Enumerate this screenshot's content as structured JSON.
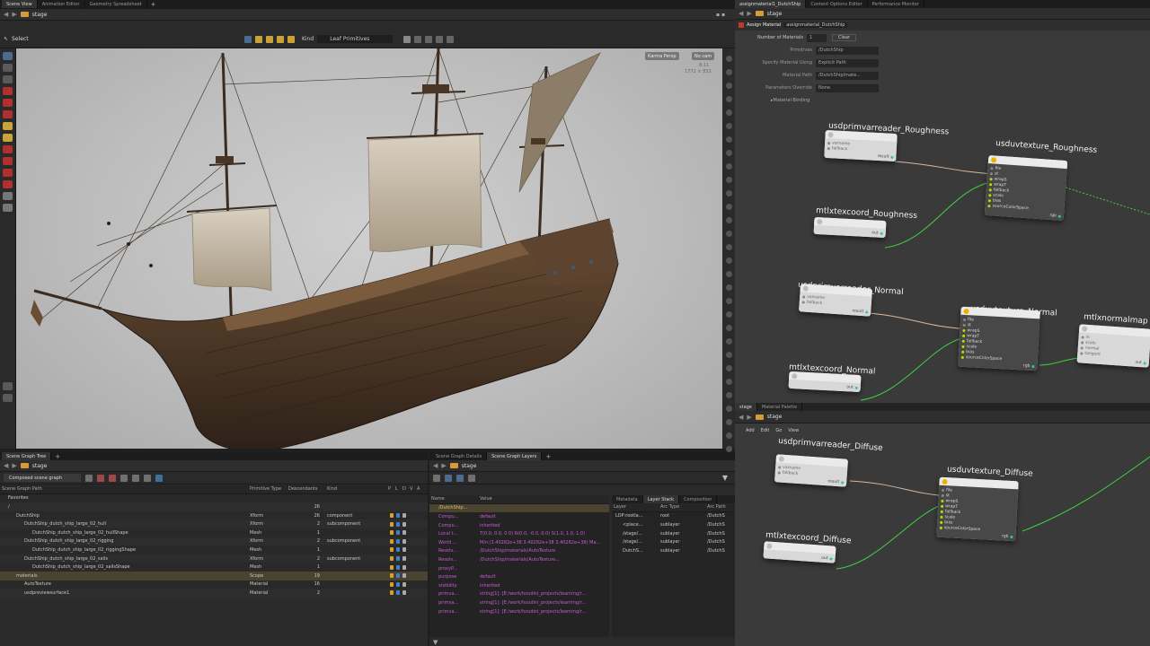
{
  "top_tabs": {
    "left": [
      "Scene View",
      "Animation Editor",
      "Geometry Spreadsheet"
    ],
    "right": [
      "assignmaterial1_DutchShip",
      "Content Options Editor",
      "Performance Monitor"
    ]
  },
  "viewport": {
    "path": "stage",
    "select_label": "Select",
    "kind_label": "Kind",
    "kind_value": "Leaf Primitives",
    "camera_btn": "Karma Persp",
    "nocam_btn": "No cam",
    "res_top": "8:11",
    "res_bottom": "1772 × 832"
  },
  "scene_tree": {
    "tab": "Scene Graph Tree",
    "path": "stage",
    "mode": "Composed scene graph",
    "headers": [
      "Scene Graph Path",
      "Primitive Type",
      "Descendants",
      "Kind",
      "P",
      "L",
      "D",
      "V",
      "A"
    ],
    "rows": [
      {
        "name": "Favorites",
        "type": "",
        "desc": "",
        "kind": "",
        "indent": 1
      },
      {
        "name": "/",
        "type": "",
        "desc": "26",
        "kind": "",
        "indent": 1
      },
      {
        "name": "DutchShip",
        "type": "Xform",
        "desc": "26",
        "kind": "component",
        "indent": 2
      },
      {
        "name": "DutchShip_dutch_ship_large_02_hull",
        "type": "Xform",
        "desc": "2",
        "kind": "subcomponent",
        "indent": 3
      },
      {
        "name": "DutchShip_dutch_ship_large_02_hullShape",
        "type": "Mesh",
        "desc": "1",
        "kind": "",
        "indent": 4
      },
      {
        "name": "DutchShip_dutch_ship_large_02_rigging",
        "type": "Xform",
        "desc": "2",
        "kind": "subcomponent",
        "indent": 3
      },
      {
        "name": "DutchShip_dutch_ship_large_02_riggingShape",
        "type": "Mesh",
        "desc": "1",
        "kind": "",
        "indent": 4
      },
      {
        "name": "DutchShip_dutch_ship_large_02_sails",
        "type": "Xform",
        "desc": "2",
        "kind": "subcomponent",
        "indent": 3
      },
      {
        "name": "DutchShip_dutch_ship_large_02_sailsShape",
        "type": "Mesh",
        "desc": "1",
        "kind": "",
        "indent": 4
      },
      {
        "name": "materials",
        "type": "Scope",
        "desc": "19",
        "kind": "",
        "indent": 2,
        "selected": true
      },
      {
        "name": "AutoTexture",
        "type": "Material",
        "desc": "16",
        "kind": "",
        "indent": 3
      },
      {
        "name": "usdpreviewsurface1",
        "type": "Material",
        "desc": "2",
        "kind": "",
        "indent": 3
      }
    ]
  },
  "details": {
    "tabs": [
      "Scene Graph Details",
      "Scene Graph Layers"
    ],
    "path": "stage",
    "headers": [
      "Name",
      "Value"
    ],
    "rows": [
      {
        "name": "/DutchShip...",
        "value": ""
      },
      {
        "name": "Compu...",
        "value": "default"
      },
      {
        "name": "Compu...",
        "value": "inherited"
      },
      {
        "name": "Local t...",
        "value": "T(0.0, 0.0, 0.0) R(0.0, -0.0, 0.0) S(1.0, 1.0, 1.0)"
      },
      {
        "name": "World ...",
        "value": "Min:(3.40282e+38 3.40282e+38 3.40282e+38) Ma..."
      },
      {
        "name": "Resolv...",
        "value": "/DutchShip/materials/AutoTexture"
      },
      {
        "name": "Resolv...",
        "value": "/DutchShip/materials/AutoTexture..."
      },
      {
        "name": "proxyP...",
        "value": ""
      },
      {
        "name": "purpose",
        "value": "default"
      },
      {
        "name": "visibility",
        "value": "inherited"
      },
      {
        "name": "primva...",
        "value": "string[1]: [E:/work/houdini_projects/learning/r..."
      },
      {
        "name": "primva...",
        "value": "string[1]: [E:/work/houdini_projects/learning/r..."
      },
      {
        "name": "primva...",
        "value": "string[1]: [E:/work/houdini_projects/learning/r..."
      }
    ]
  },
  "layers": {
    "tabs": [
      "Metadata",
      "Layer Stack",
      "Composition"
    ],
    "headers": [
      "Layer",
      "Arc Type",
      "Arc Path"
    ],
    "rows": [
      {
        "layer": "LOP:rootla...",
        "arc": "root",
        "path": "/DutchS"
      },
      {
        "layer": "<place...",
        "arc": "sublayer",
        "path": "/DutchS"
      },
      {
        "layer": "/stage/...",
        "arc": "sublayer",
        "path": "/DutchS"
      },
      {
        "layer": "/stage/...",
        "arc": "sublayer",
        "path": "/DutchS"
      },
      {
        "layer": "DutchS...",
        "arc": "sublayer",
        "path": "/DutchS"
      }
    ]
  },
  "params": {
    "path": "stage",
    "node_type": "Assign Material",
    "node_name": "assignmaterial_DutchShip",
    "num_label": "Number of Materials",
    "num_value": "1",
    "clear_btn": "Clear",
    "rows": [
      {
        "label": "Primitives",
        "value": "/DutchShip"
      },
      {
        "label": "Specify Material Using",
        "value": "Explicit Path"
      },
      {
        "label": "Material Path",
        "value": "/DutchShip/mate..."
      },
      {
        "label": "Parameters Override",
        "value": "None"
      }
    ],
    "binding": "Material Binding"
  },
  "network": {
    "path": "stage",
    "tabs": [
      "stage",
      "Material Palette"
    ],
    "menu": [
      "Add",
      "Edit",
      "Go",
      "View"
    ],
    "nodes": [
      {
        "title": "usdprimvarreader_Roughness",
        "ports": [
          "varname",
          "fallback"
        ],
        "out": "result"
      },
      {
        "title": "usduvtexture_Roughness",
        "ports": [
          "file",
          "st",
          "wrapS",
          "wrapT",
          "fallback",
          "scale",
          "bias",
          "sourceColorSpace"
        ],
        "out": "rgb"
      },
      {
        "title": "mtlxtexcoord_Roughness",
        "ports": [],
        "out": "out"
      },
      {
        "title": "usdprimvarreader_Normal",
        "ports": [
          "varname",
          "fallback"
        ],
        "out": "result"
      },
      {
        "title": "usduvtexture_Normal",
        "ports": [
          "file",
          "st",
          "wrapS",
          "wrapT",
          "fallback",
          "scale",
          "bias",
          "sourceColorSpace"
        ],
        "out": "rgb"
      },
      {
        "title": "mtlxnormalmap",
        "ports": [
          "in",
          "scale",
          "normal",
          "tangent"
        ],
        "out": "out"
      },
      {
        "title": "mtlxtexcoord_Normal",
        "ports": [],
        "out": "out"
      },
      {
        "title": "usdprimvarreader_Diffuse",
        "ports": [
          "varname",
          "fallback"
        ],
        "out": "result"
      },
      {
        "title": "usduvtexture_Diffuse",
        "ports": [
          "file",
          "st",
          "wrapS",
          "wrapT",
          "fallback",
          "scale",
          "bias",
          "sourceColorSpace"
        ],
        "out": "rgb"
      },
      {
        "title": "mtlxtexcoord_Diffuse",
        "ports": [],
        "out": "out"
      }
    ]
  }
}
